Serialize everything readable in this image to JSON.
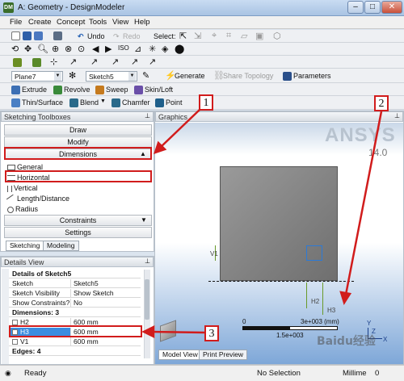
{
  "window": {
    "app_icon": "DM",
    "title": "A: Geometry - DesignModeler"
  },
  "window_buttons": {
    "minimize": "–",
    "maximize": "□",
    "close": "✕"
  },
  "menu": [
    "File",
    "Create",
    "Concept",
    "Tools",
    "View",
    "Help"
  ],
  "toolbar1": {
    "undo": "Undo",
    "redo": "Redo",
    "select": "Select:"
  },
  "toolbar3": {
    "plane": "Plane7",
    "sketch": "Sketch5",
    "generate": "Generate",
    "share_topology": "Share Topology",
    "parameters": "Parameters"
  },
  "toolbar4": {
    "extrude": "Extrude",
    "revolve": "Revolve",
    "sweep": "Sweep",
    "skin_loft": "Skin/Loft"
  },
  "toolbar5": {
    "thin_surface": "Thin/Surface",
    "blend": "Blend",
    "chamfer": "Chamfer",
    "point": "Point"
  },
  "sketching_toolboxes": {
    "title": "Sketching Toolboxes",
    "draw": "Draw",
    "modify": "Modify",
    "dimensions": "Dimensions",
    "tools": [
      "General",
      "Horizontal",
      "Vertical",
      "Length/Distance",
      "Radius"
    ],
    "constraints": "Constraints",
    "settings": "Settings",
    "tabs": [
      "Sketching",
      "Modeling"
    ]
  },
  "graphics": {
    "title": "Graphics",
    "logo": "ANSYS",
    "version": "14.0",
    "dim_v1": "V1",
    "dim_h2": "H2",
    "dim_h3": "H3",
    "scale_left": "0",
    "scale_right": "3e+003 (mm)",
    "scale_mid": "1.5e+003",
    "axis_x": "X",
    "axis_y": "Y",
    "axis_z": "Z",
    "tabs": [
      "Model View",
      "Print Preview"
    ]
  },
  "details": {
    "panel_title": "Details View",
    "header": "Details of Sketch5",
    "rows": [
      {
        "k": "Sketch",
        "v": "Sketch5"
      },
      {
        "k": "Sketch Visibility",
        "v": "Show Sketch"
      },
      {
        "k": "Show Constraints?",
        "v": "No"
      }
    ],
    "dimensions_header": "Dimensions: 3",
    "dims": [
      {
        "k": "H2",
        "v": "600 mm"
      },
      {
        "k": "H3",
        "v": "600 mm"
      },
      {
        "k": "V1",
        "v": "600 mm"
      }
    ],
    "edges_header": "Edges: 4"
  },
  "callouts": [
    "1",
    "2",
    "3"
  ],
  "status": {
    "ready": "Ready",
    "selection": "No Selection",
    "units": "Millime",
    "value": "0"
  },
  "watermark": "Baidu经验",
  "colors": {
    "highlight_red": "#d11c1c",
    "selected_blue": "#3b8de0",
    "dim_green": "#6a9a2a"
  }
}
